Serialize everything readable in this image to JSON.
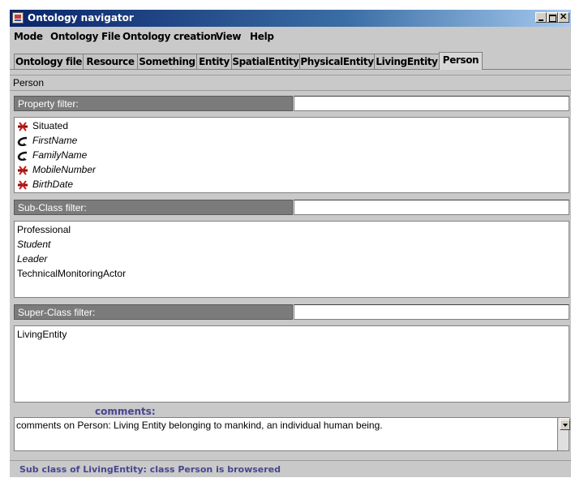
{
  "window": {
    "title": "Ontology navigator"
  },
  "menu": [
    "Mode",
    "Ontology File",
    "Ontology creation",
    "View",
    "Help"
  ],
  "tabs": [
    "Ontology file",
    "Resource",
    "Something",
    "Entity",
    "SpatialEntity",
    "PhysicalEntity",
    "LivingEntity",
    "Person"
  ],
  "active_tab": "Person",
  "breadcrumb": "Person",
  "property_filter": {
    "label": "Property filter:",
    "value": ""
  },
  "properties": [
    {
      "label": "Situated",
      "italic": false,
      "icon": "red-cross-property-icon"
    },
    {
      "label": "FirstName",
      "italic": true,
      "icon": "black-arrow-property-icon"
    },
    {
      "label": "FamilyName",
      "italic": true,
      "icon": "black-arrow-property-icon"
    },
    {
      "label": "MobileNumber",
      "italic": true,
      "icon": "red-cross-property-icon"
    },
    {
      "label": "BirthDate",
      "italic": true,
      "icon": "red-cross-property-icon"
    }
  ],
  "subclass_filter": {
    "label": "Sub-Class filter:",
    "value": ""
  },
  "subclasses": [
    {
      "label": "Professional",
      "italic": false
    },
    {
      "label": "Student",
      "italic": true
    },
    {
      "label": "Leader",
      "italic": true
    },
    {
      "label": "TechnicalMonitoringActor",
      "italic": false
    }
  ],
  "superclass_filter": {
    "label": "Super-Class filter:",
    "value": ""
  },
  "superclasses": [
    {
      "label": "LivingEntity",
      "italic": false
    }
  ],
  "comments": {
    "label": "comments:",
    "text": "comments on Person: Living Entity belonging to mankind, an individual human being."
  },
  "status": "Sub class of LivingEntity: class Person is browsered",
  "colors": {
    "title_gradient_start": "#0a246a",
    "filter_label_bg": "#7b7b7b",
    "status_text": "#474790",
    "window_bg": "#c9c9c9"
  }
}
